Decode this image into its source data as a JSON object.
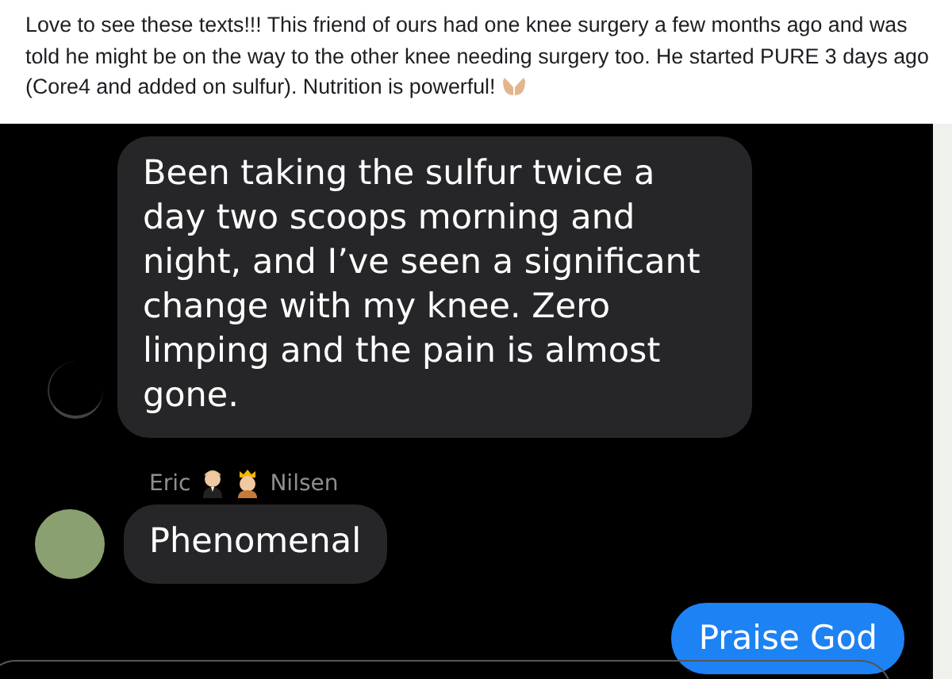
{
  "post": {
    "caption": "Love to see these texts!!! This friend of ours had one knee surgery a few months ago and was told he might be on the way to the other knee needing surgery too. He started PURE 3 days ago (Core4 and added on sulfur). Nutrition is powerful!"
  },
  "messages": [
    {
      "kind": "received",
      "text": "Been taking the sulfur twice a day two scoops morning and night, and I’ve seen a significant change with my knee. Zero limping and the pain is almost gone."
    },
    {
      "kind": "sender",
      "first": "Eric",
      "last": "Nilsen"
    },
    {
      "kind": "received_avatar",
      "text": "Phenomenal"
    },
    {
      "kind": "sent",
      "text": "Praise God"
    }
  ]
}
